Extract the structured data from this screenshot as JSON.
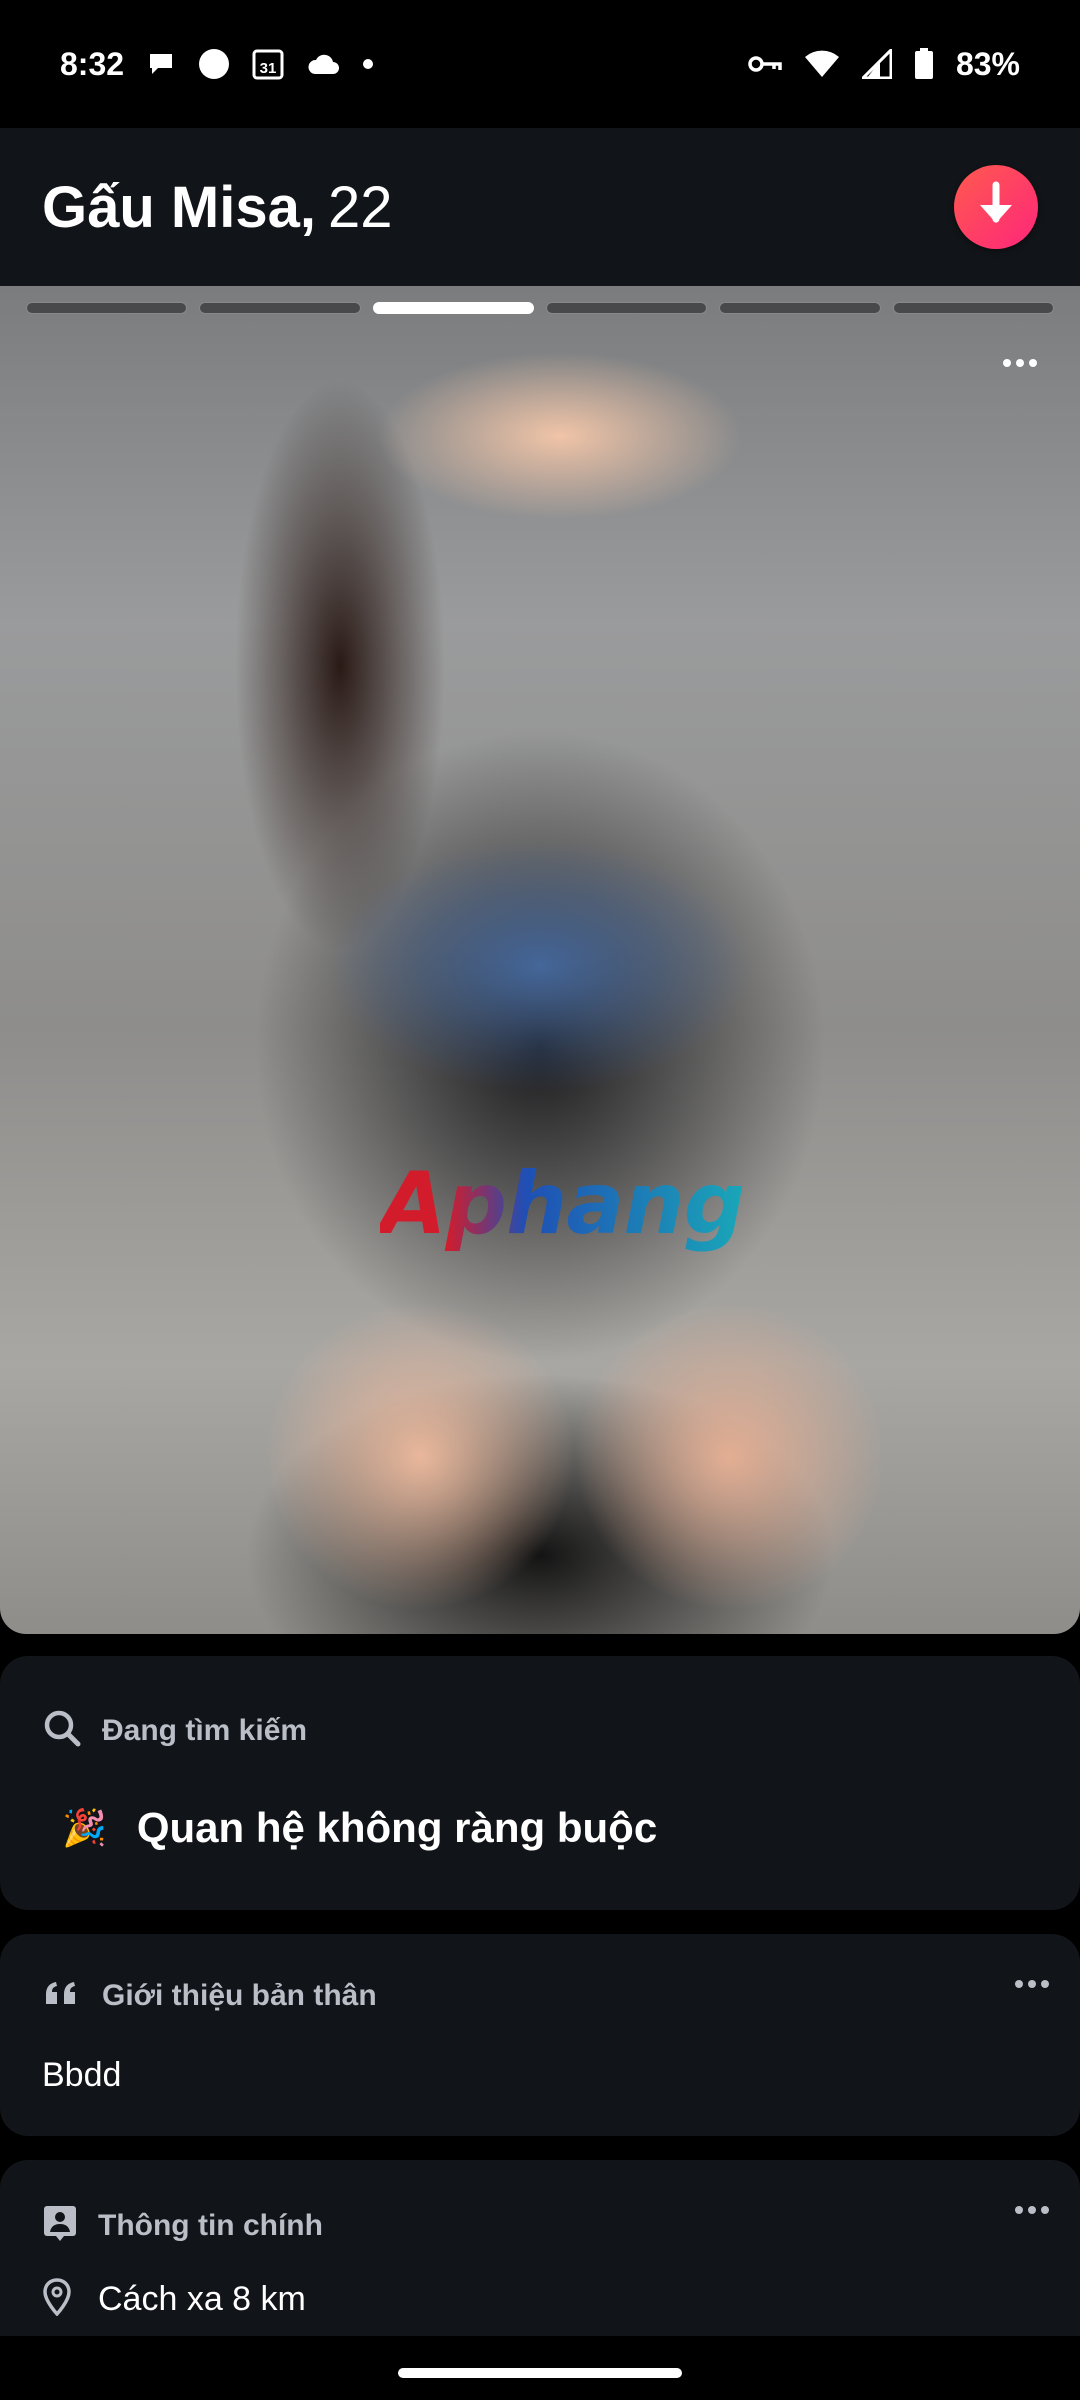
{
  "status_bar": {
    "time": "8:32",
    "calendar_day": "31",
    "battery": "83%",
    "icons_left": [
      "chat-bubble-icon",
      "circle-icon",
      "calendar-icon",
      "cloud-icon",
      "dot-icon"
    ],
    "icons_right": [
      "vpn-key-icon",
      "wifi-icon",
      "signal-icon",
      "battery-icon"
    ]
  },
  "profile": {
    "name": "Gấu Misa,",
    "age": "22"
  },
  "photo": {
    "total_photos": 6,
    "active_index": 2,
    "watermark": "Aphang"
  },
  "looking_for": {
    "label": "Đang tìm kiếm",
    "emoji": "🎉",
    "value": "Quan hệ không ràng buộc"
  },
  "about": {
    "label": "Giới thiệu bản thân",
    "text": "Bbdd"
  },
  "basics": {
    "label": "Thông tin chính",
    "distance": "Cách xa 8 km"
  },
  "colors": {
    "background": "#000000",
    "card": "#111418",
    "muted_label": "#b9bec7",
    "accent_gradient_start": "#ff5a4e",
    "accent_gradient_end": "#fd267a"
  }
}
